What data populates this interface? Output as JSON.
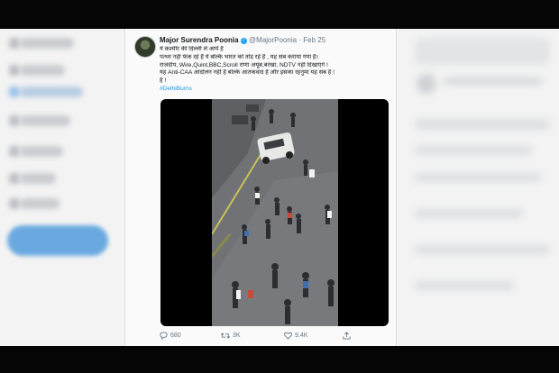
{
  "tweet": {
    "author": "Major Surendra Poonia",
    "handle": "@MajorPoonia",
    "separator": "·",
    "date": "Feb 25",
    "lines": [
      "ये कश्मीर की दिल्ली ले आये हैं",
      "पत्थर नहीं फेंक रहे हैं ये बल्कि भारत को तोड़ रहे हैं , यह सब कराया गया है।",
      "राजदीप, Wire,Quint,BBC,Scroll राणा अयूब,बरखा, NDTV नहीं दिखाएंगे !",
      "यह Anti-CAA आंदोलन नहीं है बल्कि आतंकवाद है और इसका रहनुमा यह सब है !",
      "है !"
    ],
    "hashtag": "#DelhiBurns",
    "reply_count": "680",
    "retweet_count": "3K",
    "like_count": "9.4K"
  },
  "colors": {
    "link": "#1b95e0",
    "verified": "#1da1f2",
    "muted": "#657786"
  },
  "icons": [
    "reply-icon",
    "retweet-icon",
    "like-icon",
    "share-icon",
    "verified-icon"
  ]
}
